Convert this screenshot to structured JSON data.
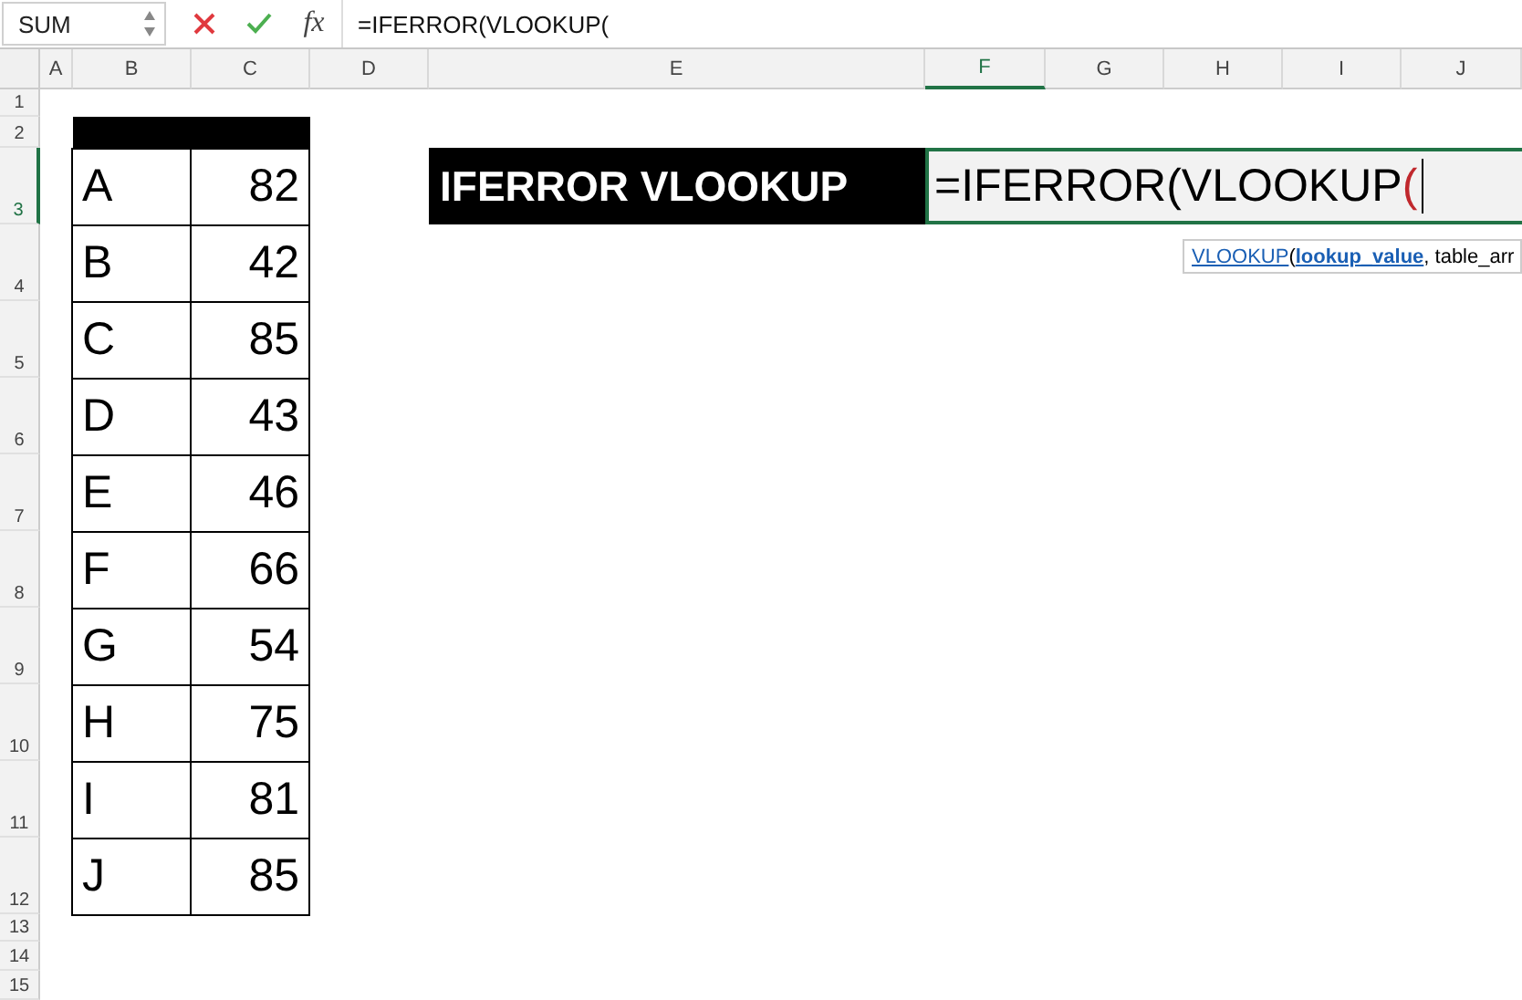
{
  "name_box": {
    "value": "SUM"
  },
  "formula_bar": {
    "function_symbol": "fx",
    "value": "=IFERROR(VLOOKUP("
  },
  "columns": [
    {
      "label": "A",
      "selected": false
    },
    {
      "label": "B",
      "selected": false
    },
    {
      "label": "C",
      "selected": false
    },
    {
      "label": "D",
      "selected": false
    },
    {
      "label": "E",
      "selected": false
    },
    {
      "label": "F",
      "selected": true
    },
    {
      "label": "G",
      "selected": false
    },
    {
      "label": "H",
      "selected": false
    },
    {
      "label": "I",
      "selected": false
    },
    {
      "label": "J",
      "selected": false
    }
  ],
  "rows": [
    {
      "label": "1",
      "selected": false
    },
    {
      "label": "2",
      "selected": false
    },
    {
      "label": "3",
      "selected": true
    },
    {
      "label": "4",
      "selected": false
    },
    {
      "label": "5",
      "selected": false
    },
    {
      "label": "6",
      "selected": false
    },
    {
      "label": "7",
      "selected": false
    },
    {
      "label": "8",
      "selected": false
    },
    {
      "label": "9",
      "selected": false
    },
    {
      "label": "10",
      "selected": false
    },
    {
      "label": "11",
      "selected": false
    },
    {
      "label": "12",
      "selected": false
    },
    {
      "label": "13",
      "selected": false
    },
    {
      "label": "14",
      "selected": false
    },
    {
      "label": "15",
      "selected": false
    }
  ],
  "table": [
    {
      "letter": "A",
      "value": "82"
    },
    {
      "letter": "B",
      "value": "42"
    },
    {
      "letter": "C",
      "value": "85"
    },
    {
      "letter": "D",
      "value": "43"
    },
    {
      "letter": "E",
      "value": "46"
    },
    {
      "letter": "F",
      "value": "66"
    },
    {
      "letter": "G",
      "value": "54"
    },
    {
      "letter": "H",
      "value": "75"
    },
    {
      "letter": "I",
      "value": "81"
    },
    {
      "letter": "J",
      "value": "85"
    }
  ],
  "title_cell": "IFERROR VLOOKUP",
  "edit_cell": {
    "text": "=IFERROR(VLOOKUP",
    "open_paren": "("
  },
  "tooltip": {
    "function": "VLOOKUP",
    "paren": "(",
    "argument": "lookup_value",
    "rest": ", table_arr"
  }
}
